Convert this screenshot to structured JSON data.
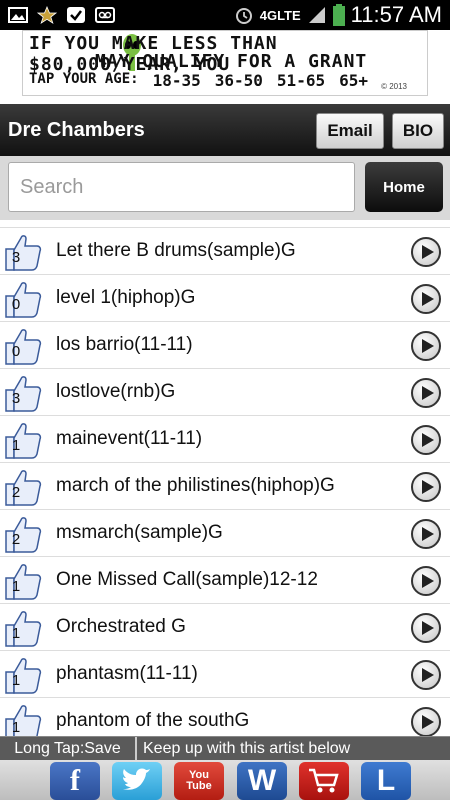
{
  "status_bar": {
    "network": "4GLTE",
    "time": "11:57 AM"
  },
  "ad": {
    "line1": "IF YOU MAKE LESS THAN $80,000/YEAR, YOU",
    "line2": "MAY QUALIFY FOR A GRANT",
    "tap_label": "TAP YOUR AGE:",
    "ages": [
      "18-35",
      "36-50",
      "51-65",
      "65+"
    ],
    "copyright": "© 2013"
  },
  "header": {
    "artist_name": "Dre Chambers",
    "email_label": "Email",
    "bio_label": "BIO"
  },
  "search": {
    "placeholder": "Search",
    "home_label": "Home"
  },
  "tracks": [
    {
      "likes": "3",
      "title": "Let there B drums(sample)G"
    },
    {
      "likes": "0",
      "title": "level 1(hiphop)G"
    },
    {
      "likes": "0",
      "title": "los barrio(11-11)"
    },
    {
      "likes": "3",
      "title": "lostlove(rnb)G"
    },
    {
      "likes": "1",
      "title": "mainevent(11-11)"
    },
    {
      "likes": "2",
      "title": "march of the philistines(hiphop)G"
    },
    {
      "likes": "2",
      "title": "msmarch(sample)G"
    },
    {
      "likes": "1",
      "title": "One Missed Call(sample)12-12"
    },
    {
      "likes": "1",
      "title": "Orchestrated G"
    },
    {
      "likes": "1",
      "title": "phantasm(11-11)"
    },
    {
      "likes": "1",
      "title": "phantom of the southG"
    }
  ],
  "info_bar": {
    "hint": "Long Tap:Save",
    "follow_text": "Keep up with this artist below"
  },
  "social": {
    "facebook": "f",
    "youtube_top": "You",
    "youtube_bottom": "Tube",
    "w": "W",
    "l": "L"
  }
}
